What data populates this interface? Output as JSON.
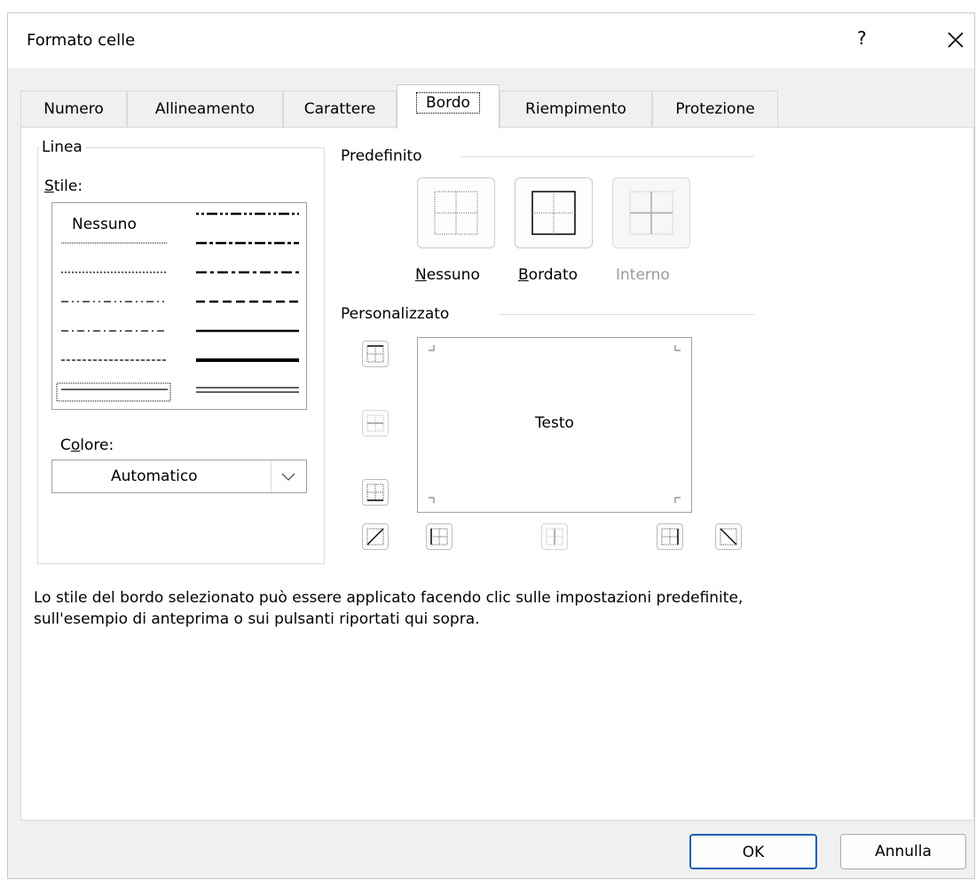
{
  "window": {
    "title": "Formato celle",
    "help": "?",
    "close_icon": "close-icon"
  },
  "tabs": [
    {
      "label": "Numero"
    },
    {
      "label": "Allineamento"
    },
    {
      "label": "Carattere"
    },
    {
      "label": "Bordo"
    },
    {
      "label": "Riempimento"
    },
    {
      "label": "Protezione"
    }
  ],
  "linea": {
    "group_label": "Linea",
    "stile_label_accel": "S",
    "stile_label_rest": "tile:",
    "none_label": "Nessuno",
    "colore_label_a": "C",
    "colore_label_accel": "o",
    "colore_label_rest": "lore:",
    "color_value": "Automatico"
  },
  "predefinito": {
    "label": "Predefinito",
    "presets": [
      {
        "accel": "N",
        "rest": "essuno",
        "enabled": true
      },
      {
        "accel": "B",
        "rest": "ordato",
        "enabled": true
      },
      {
        "accel": "",
        "rest": "Interno",
        "enabled": false
      }
    ]
  },
  "personalizzato": {
    "label": "Personalizzato",
    "preview_text": "Testo"
  },
  "help_text": {
    "line1": "Lo stile del bordo selezionato può essere applicato facendo clic sulle impostazioni predefinite,",
    "line2": "sull'esempio di anteprima o sui pulsanti riportati qui sopra."
  },
  "buttons": {
    "ok": "OK",
    "cancel": "Annulla"
  }
}
